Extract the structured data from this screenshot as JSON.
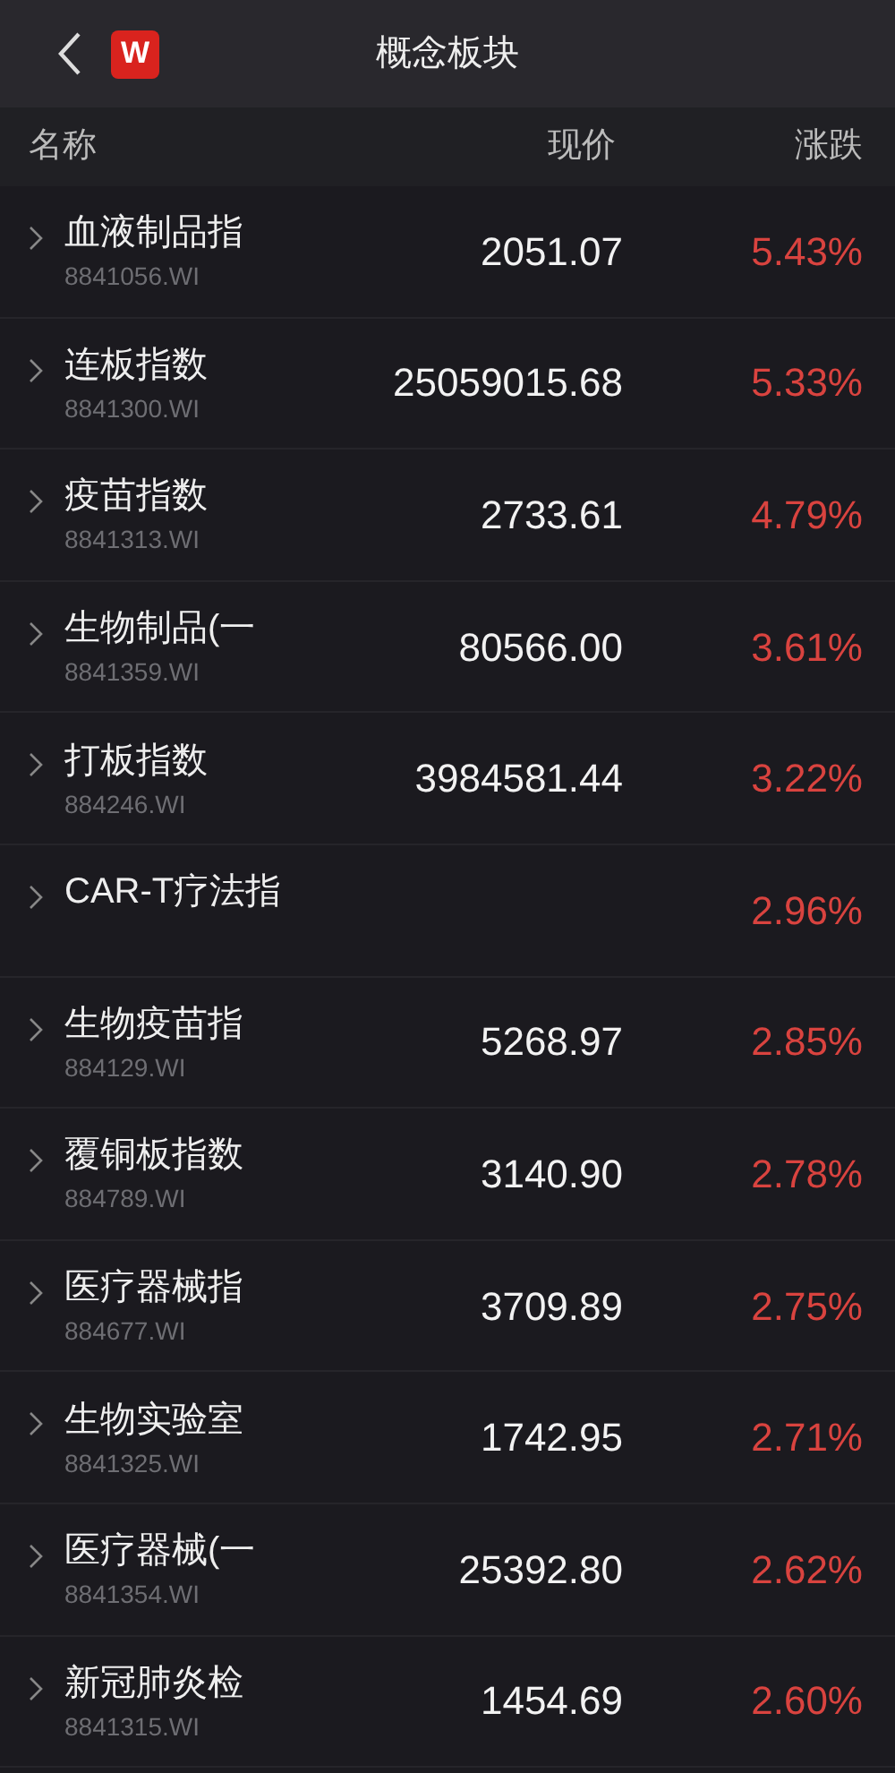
{
  "header": {
    "logo": "W",
    "title": "概念板块"
  },
  "columns": [
    "名称",
    "现价",
    "涨跌"
  ],
  "rows": [
    {
      "name": "血液制品指",
      "code": "8841056.WI",
      "price": "2051.07",
      "change": "5.43%"
    },
    {
      "name": "连板指数",
      "code": "8841300.WI",
      "price": "25059015.68",
      "change": "5.33%"
    },
    {
      "name": "疫苗指数",
      "code": "8841313.WI",
      "price": "2733.61",
      "change": "4.79%"
    },
    {
      "name": "生物制品(一",
      "code": "8841359.WI",
      "price": "80566.00",
      "change": "3.61%"
    },
    {
      "name": "打板指数",
      "code": "884246.WI",
      "price": "3984581.44",
      "change": "3.22%"
    },
    {
      "name": "CAR-T疗法指",
      "change": "2.96%"
    },
    {
      "name": "生物疫苗指",
      "code": "884129.WI",
      "price": "5268.97",
      "change": "2.85%"
    },
    {
      "name": "覆铜板指数",
      "code": "884789.WI",
      "price": "3140.90",
      "change": "2.78%"
    },
    {
      "name": "医疗器械指",
      "code": "884677.WI",
      "price": "3709.89",
      "change": "2.75%"
    },
    {
      "name": "生物实验室",
      "code": "8841325.WI",
      "price": "1742.95",
      "change": "2.71%"
    },
    {
      "name": "医疗器械(一",
      "code": "8841354.WI",
      "price": "25392.80",
      "change": "2.62%"
    },
    {
      "name": "新冠肺炎检",
      "code": "8841315.WI",
      "price": "1454.69",
      "change": "2.60%"
    }
  ]
}
